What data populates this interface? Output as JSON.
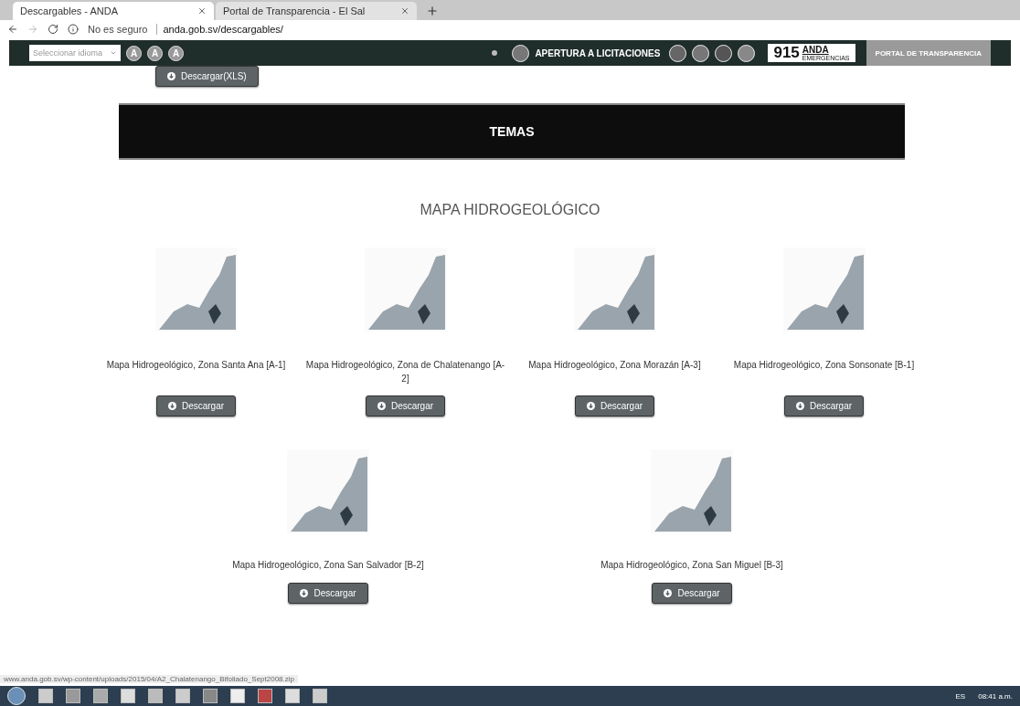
{
  "browser": {
    "tabs": [
      {
        "label": "Descargables - ANDA",
        "selected": true
      },
      {
        "label": "Portal de Transparencia - El Sal",
        "selected": false
      }
    ],
    "security": "No es seguro",
    "url": "anda.gob.sv/descargables/"
  },
  "site_nav": {
    "language_select": {
      "placeholder": "Seleccionar idioma"
    },
    "font_buttons": [
      "A",
      "A",
      "A"
    ],
    "tenders_link": "APERTURA A LICITACIONES",
    "emergency_number": "915",
    "emergency_brand": "ANDA",
    "emergency_caption": "EMERGENCIAS",
    "transparency_link": "PORTAL DE TRANSPARENCIA"
  },
  "xls_button": "Descargar(XLS)",
  "section_bar": "TEMAS",
  "heading": "MAPA HIDROGEOLÓGICO",
  "rows": [
    [
      {
        "title": "Mapa Hidrogeológico, Zona Santa Ana [A-1]",
        "button": "Descargar"
      },
      {
        "title": "Mapa Hidrogeológico, Zona de Chalatenango [A-2]",
        "button": "Descargar"
      },
      {
        "title": "Mapa Hidrogeológico, Zona Morazán [A-3]",
        "button": "Descargar"
      },
      {
        "title": "Mapa Hidrogeológico, Zona Sonsonate [B-1]",
        "button": "Descargar"
      }
    ],
    [
      {
        "title": "Mapa Hidrogeológico, Zona San Salvador [B-2]",
        "button": "Descargar"
      },
      {
        "title": "Mapa Hidrogeológico, Zona San Miguel [B-3]",
        "button": "Descargar"
      }
    ]
  ],
  "status_url": "www.anda.gob.sv/wp-content/uploads/2015/04/A2_Chalatenango_Bifoliado_Sept2008.zip",
  "taskbar": {
    "language": "ES",
    "time": "08:41 a.m."
  }
}
